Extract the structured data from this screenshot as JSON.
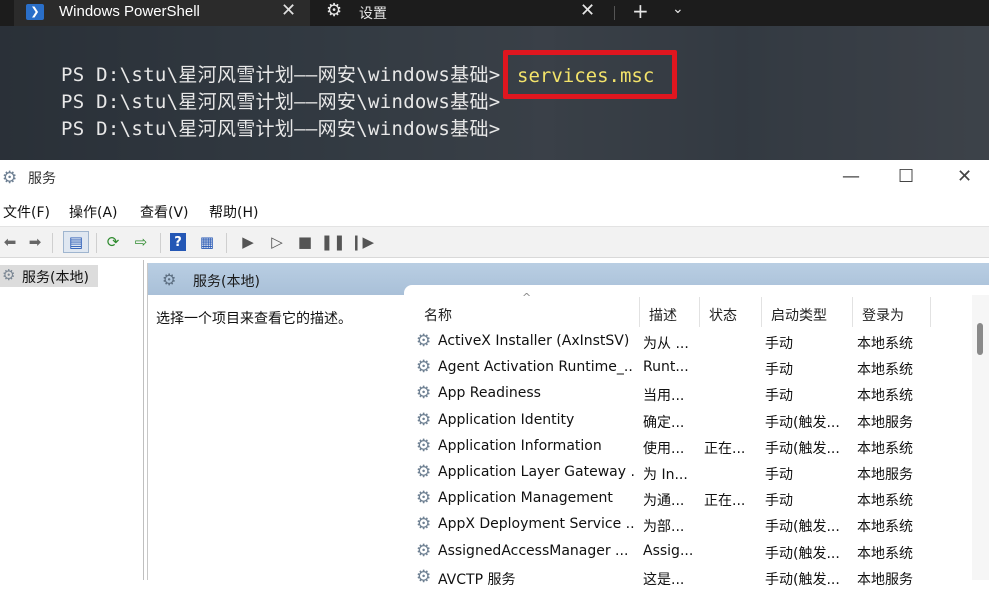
{
  "terminal": {
    "tab_title": "Windows PowerShell",
    "tab_icon": "powershell-icon",
    "settings_tab_title": "设置",
    "settings_tab_icon": "gear-icon",
    "close_glyph": "✕",
    "new_tab_glyph": "+",
    "dropdown_glyph": "⌄",
    "lines": [
      {
        "prompt": "PS D:\\stu\\星河风雪计划——网安\\windows基础>",
        "command": ""
      },
      {
        "prompt": "PS D:\\stu\\星河风雪计划——网安\\windows基础>",
        "command": "services.msc"
      },
      {
        "prompt": "PS D:\\stu\\星河风雪计划——网安\\windows基础>",
        "command": ""
      }
    ],
    "highlight_color": "#e0161f",
    "command_color": "#f3e36a"
  },
  "window": {
    "title": "服务",
    "title_icon": "services-gear-icon",
    "minimize_glyph": "—",
    "maximize_glyph": "☐",
    "close_glyph": "✕"
  },
  "menu": {
    "file": "文件(F)",
    "action": "操作(A)",
    "view": "查看(V)",
    "help": "帮助(H)"
  },
  "toolbar": {
    "back": "back-arrow-icon",
    "forward": "forward-arrow-icon",
    "show_hide_tree": "console-tree-icon",
    "refresh": "refresh-icon",
    "export": "export-list-icon",
    "help": "help-icon",
    "properties": "properties-icon",
    "start": "start-service-icon",
    "start_params": "start-service-params-icon",
    "stop": "stop-service-icon",
    "pause": "pause-service-icon",
    "resume": "resume-service-icon"
  },
  "tree": {
    "root_label": "服务(本地)"
  },
  "pane": {
    "header": "服务(本地)",
    "description_hint": "选择一个项目来查看它的描述。",
    "columns": {
      "name": "名称",
      "description": "描述",
      "status": "状态",
      "startup_type": "启动类型",
      "logon_as": "登录为"
    },
    "rows": [
      {
        "name": "ActiveX Installer (AxInstSV)",
        "description": "为从 ...",
        "status": "",
        "startup": "手动",
        "logon": "本地系统"
      },
      {
        "name": "Agent Activation Runtime_...",
        "description": "Runt...",
        "status": "",
        "startup": "手动",
        "logon": "本地系统"
      },
      {
        "name": "App Readiness",
        "description": "当用...",
        "status": "",
        "startup": "手动",
        "logon": "本地系统"
      },
      {
        "name": "Application Identity",
        "description": "确定...",
        "status": "",
        "startup": "手动(触发...",
        "logon": "本地服务"
      },
      {
        "name": "Application Information",
        "description": "使用...",
        "status": "正在...",
        "startup": "手动(触发...",
        "logon": "本地系统"
      },
      {
        "name": "Application Layer Gateway ...",
        "description": "为 In...",
        "status": "",
        "startup": "手动",
        "logon": "本地服务"
      },
      {
        "name": "Application Management",
        "description": "为通...",
        "status": "正在...",
        "startup": "手动",
        "logon": "本地系统"
      },
      {
        "name": "AppX Deployment Service ...",
        "description": "为部...",
        "status": "",
        "startup": "手动(触发...",
        "logon": "本地系统"
      },
      {
        "name": "AssignedAccessManager ...",
        "description": "Assig...",
        "status": "",
        "startup": "手动(触发...",
        "logon": "本地系统"
      },
      {
        "name": "AVCTP 服务",
        "description": "这是...",
        "status": "",
        "startup": "手动(触发...",
        "logon": "本地服务"
      }
    ]
  }
}
